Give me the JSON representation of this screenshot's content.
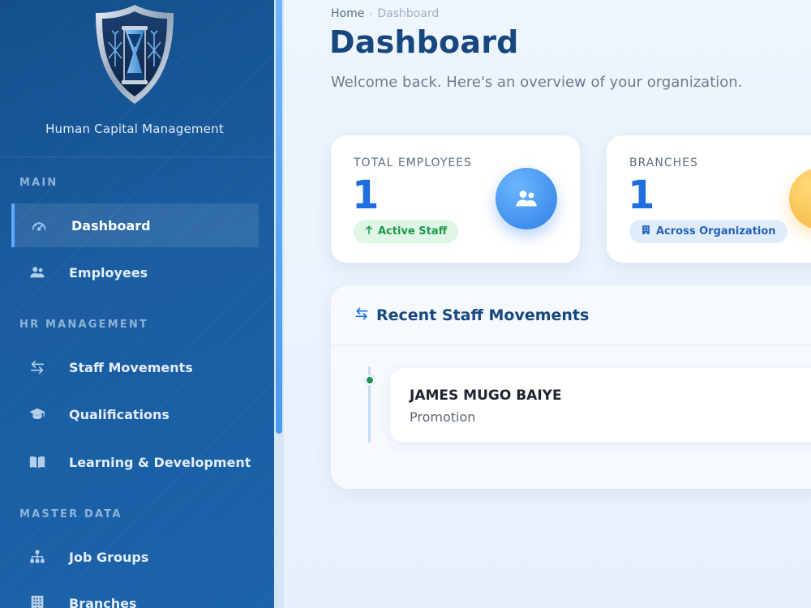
{
  "sidebar": {
    "org_name": "Human Capital Management",
    "sections": {
      "main": "MAIN",
      "hr": "HR MANAGEMENT",
      "master": "MASTER DATA"
    },
    "items": [
      {
        "label": "Dashboard",
        "icon": "gauge-icon",
        "active": true
      },
      {
        "label": "Employees",
        "icon": "users-icon"
      },
      {
        "label": "Staff Movements",
        "icon": "swap-arrows-icon"
      },
      {
        "label": "Qualifications",
        "icon": "graduation-cap-icon"
      },
      {
        "label": "Learning & Development",
        "icon": "book-icon"
      },
      {
        "label": "Job Groups",
        "icon": "sitemap-icon"
      },
      {
        "label": "Branches",
        "icon": "building-icon"
      }
    ]
  },
  "breadcrumb": {
    "home": "Home",
    "current": "Dashboard"
  },
  "page": {
    "title": "Dashboard",
    "subtitle": "Welcome back. Here's an overview of your organization."
  },
  "stats": [
    {
      "label": "TOTAL EMPLOYEES",
      "value": "1",
      "badge": "Active Staff",
      "badge_icon": "arrow-up-icon",
      "icon": "users-icon",
      "color": "#2f7fe6"
    },
    {
      "label": "BRANCHES",
      "value": "1",
      "badge": "Across Organization",
      "badge_icon": "building-icon",
      "icon": "building-icon",
      "color": "#f5b53c"
    }
  ],
  "movements": {
    "title": "Recent Staff Movements",
    "items": [
      {
        "name": "JAMES MUGO BAIYE",
        "type": "Promotion"
      }
    ]
  },
  "colors": {
    "sidebar": "#1a5da0",
    "accent": "#1e6ee0",
    "title": "#17477f",
    "success": "#1c9a4a"
  }
}
